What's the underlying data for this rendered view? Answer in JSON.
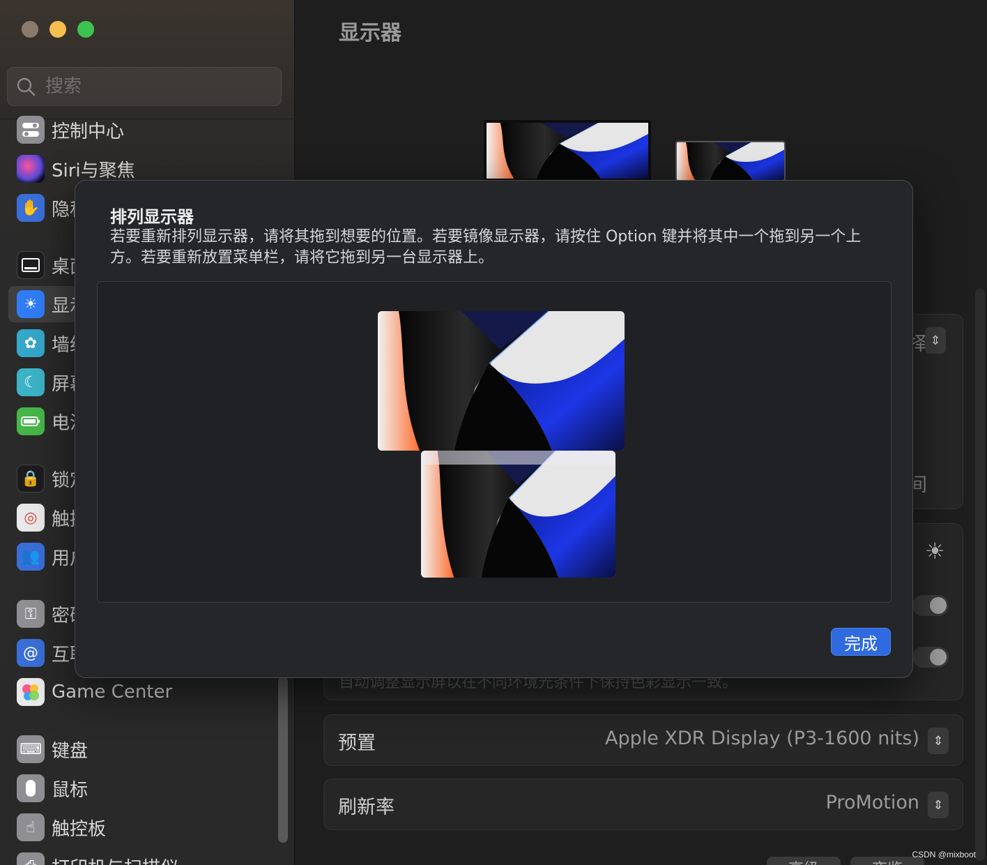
{
  "sidebar": {
    "search_placeholder": "搜索",
    "items": [
      {
        "label": "控制中心",
        "icon": "toggles-icon",
        "color": "#8e8e93"
      },
      {
        "label": "Siri与聚焦",
        "icon": "siri-icon",
        "color": "#5b4bd6"
      },
      {
        "label": "隐私",
        "icon": "hand-icon",
        "color": "#3a6fd8"
      },
      {
        "label": "桌面",
        "icon": "dock-icon",
        "color": "#1c1c1e"
      },
      {
        "label": "显示",
        "icon": "sun-icon",
        "color": "#2f7cf6"
      },
      {
        "label": "墙纸",
        "icon": "flower-icon",
        "color": "#35a7c9"
      },
      {
        "label": "屏幕",
        "icon": "screensaver-icon",
        "color": "#3cb3c7"
      },
      {
        "label": "电池",
        "icon": "battery-icon",
        "color": "#45b649"
      },
      {
        "label": "锁定",
        "icon": "lock-icon",
        "color": "#1c1c1e"
      },
      {
        "label": "触控",
        "icon": "fingerprint-icon",
        "color": "#e9e9e9"
      },
      {
        "label": "用户",
        "icon": "users-icon",
        "color": "#3a6fd8"
      },
      {
        "label": "密码",
        "icon": "key-icon",
        "color": "#8e8e93"
      },
      {
        "label": "互联",
        "icon": "at-icon",
        "color": "#3a6fd8"
      },
      {
        "label": "Game Center",
        "icon": "game-center-icon",
        "color": "#e9e9e9"
      },
      {
        "label": "键盘",
        "icon": "keyboard-icon",
        "color": "#8e8e93"
      },
      {
        "label": "鼠标",
        "icon": "mouse-icon",
        "color": "#8e8e93"
      },
      {
        "label": "触控板",
        "icon": "trackpad-icon",
        "color": "#8e8e93"
      },
      {
        "label": "打印机与扫描仪",
        "icon": "printer-icon",
        "color": "#8e8e93"
      }
    ]
  },
  "main": {
    "title": "显示器",
    "preset_label": "预置",
    "preset_value": "Apple XDR Display (P3-1600 nits)",
    "refresh_label": "刷新率",
    "refresh_value": "ProMotion",
    "occluded_caption": "自动调整显示屏以在不同环境光条件下保持色彩显示一致。",
    "side_text_1": "择",
    "side_text_2": "间",
    "bottom_btn_1": "高级",
    "bottom_btn_2": "夜览"
  },
  "sheet": {
    "title": "排列显示器",
    "description": "若要重新排列显示器，请将其拖到想要的位置。若要镜像显示器，请按住 Option 键并将其中一个拖到另一个上方。若要重新放置菜单栏，请将它拖到另一台显示器上。",
    "done_label": "完成"
  },
  "watermark": "CSDN @mixboot",
  "colors": {
    "accent": "#2f6ae0",
    "close": "#8a7a6b",
    "minimize": "#f5be4f",
    "maximize": "#3ec351"
  }
}
